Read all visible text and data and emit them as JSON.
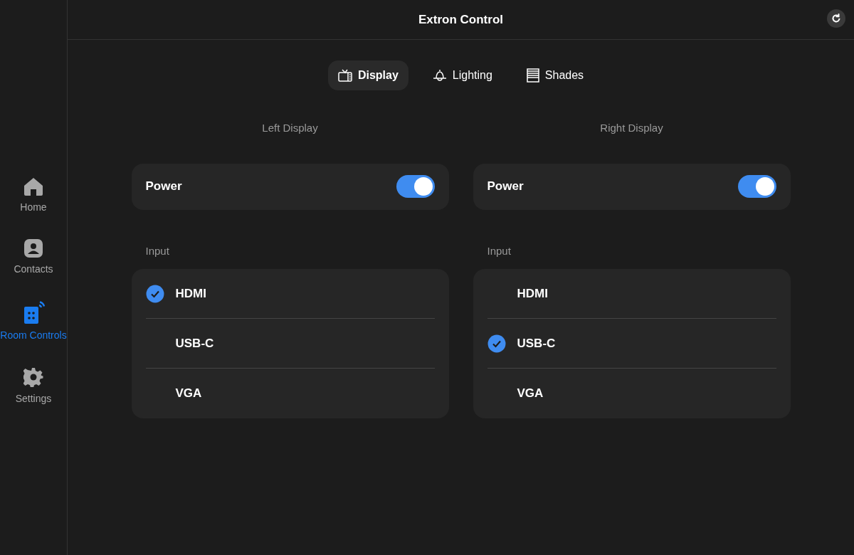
{
  "window": {
    "title": "Extron Control"
  },
  "sidebar": {
    "items": [
      {
        "kind": "home",
        "label": "Home",
        "selected": false
      },
      {
        "kind": "contacts",
        "label": "Contacts",
        "selected": false
      },
      {
        "kind": "room",
        "label": "Room Controls",
        "selected": true
      },
      {
        "kind": "settings",
        "label": "Settings",
        "selected": false
      }
    ]
  },
  "tabs": [
    {
      "kind": "display",
      "label": "Display",
      "selected": true
    },
    {
      "kind": "lighting",
      "label": "Lighting",
      "selected": false
    },
    {
      "kind": "shades",
      "label": "Shades",
      "selected": false
    }
  ],
  "displays": [
    {
      "title": "Left Display",
      "power": {
        "label": "Power",
        "on": true
      },
      "input_label": "Input",
      "inputs": [
        {
          "label": "HDMI",
          "selected": true
        },
        {
          "label": "USB-C",
          "selected": false
        },
        {
          "label": "VGA",
          "selected": false
        }
      ]
    },
    {
      "title": "Right Display",
      "power": {
        "label": "Power",
        "on": true
      },
      "input_label": "Input",
      "inputs": [
        {
          "label": "HDMI",
          "selected": false
        },
        {
          "label": "USB-C",
          "selected": true
        },
        {
          "label": "VGA",
          "selected": false
        }
      ]
    }
  ]
}
